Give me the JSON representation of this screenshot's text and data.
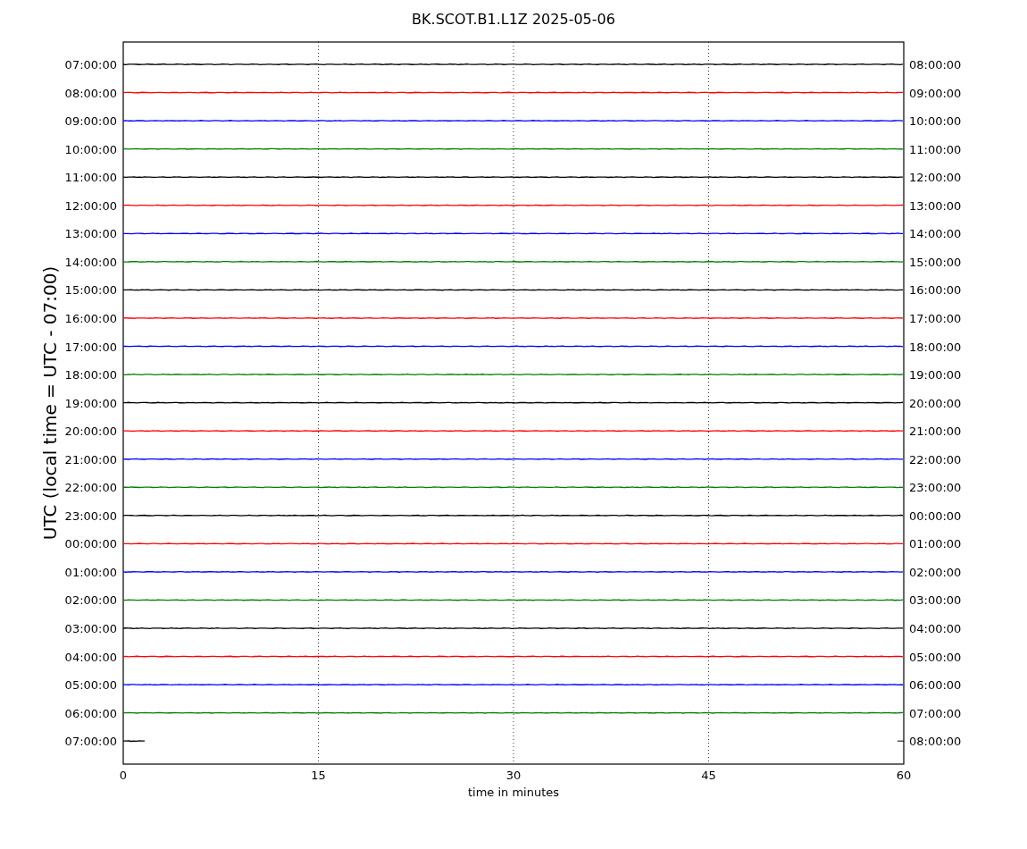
{
  "title": "BK.SCOT.B1.L1Z 2025-05-06",
  "ylabel": "UTC (local time = UTC - 07:00)",
  "xlabel": "time in minutes",
  "xticks": [
    "0",
    "15",
    "30",
    "45",
    "60"
  ],
  "traces": [
    {
      "left": "07:00:00",
      "right": "08:00:00",
      "color": "#000000",
      "kind": "full"
    },
    {
      "left": "08:00:00",
      "right": "09:00:00",
      "color": "#ff0000",
      "kind": "full"
    },
    {
      "left": "09:00:00",
      "right": "10:00:00",
      "color": "#0000ff",
      "kind": "full"
    },
    {
      "left": "10:00:00",
      "right": "11:00:00",
      "color": "#008000",
      "kind": "full"
    },
    {
      "left": "11:00:00",
      "right": "12:00:00",
      "color": "#000000",
      "kind": "full"
    },
    {
      "left": "12:00:00",
      "right": "13:00:00",
      "color": "#ff0000",
      "kind": "full"
    },
    {
      "left": "13:00:00",
      "right": "14:00:00",
      "color": "#0000ff",
      "kind": "full"
    },
    {
      "left": "14:00:00",
      "right": "15:00:00",
      "color": "#008000",
      "kind": "full"
    },
    {
      "left": "15:00:00",
      "right": "16:00:00",
      "color": "#000000",
      "kind": "full"
    },
    {
      "left": "16:00:00",
      "right": "17:00:00",
      "color": "#ff0000",
      "kind": "full"
    },
    {
      "left": "17:00:00",
      "right": "18:00:00",
      "color": "#0000ff",
      "kind": "full"
    },
    {
      "left": "18:00:00",
      "right": "19:00:00",
      "color": "#008000",
      "kind": "full"
    },
    {
      "left": "19:00:00",
      "right": "20:00:00",
      "color": "#000000",
      "kind": "full"
    },
    {
      "left": "20:00:00",
      "right": "21:00:00",
      "color": "#ff0000",
      "kind": "full"
    },
    {
      "left": "21:00:00",
      "right": "22:00:00",
      "color": "#0000ff",
      "kind": "full"
    },
    {
      "left": "22:00:00",
      "right": "23:00:00",
      "color": "#008000",
      "kind": "full"
    },
    {
      "left": "23:00:00",
      "right": "00:00:00",
      "color": "#000000",
      "kind": "full"
    },
    {
      "left": "00:00:00",
      "right": "01:00:00",
      "color": "#ff0000",
      "kind": "full"
    },
    {
      "left": "01:00:00",
      "right": "02:00:00",
      "color": "#0000ff",
      "kind": "full"
    },
    {
      "left": "02:00:00",
      "right": "03:00:00",
      "color": "#008000",
      "kind": "full"
    },
    {
      "left": "03:00:00",
      "right": "04:00:00",
      "color": "#000000",
      "kind": "full"
    },
    {
      "left": "04:00:00",
      "right": "05:00:00",
      "color": "#ff0000",
      "kind": "full"
    },
    {
      "left": "05:00:00",
      "right": "06:00:00",
      "color": "#0000ff",
      "kind": "full"
    },
    {
      "left": "06:00:00",
      "right": "07:00:00",
      "color": "#008000",
      "kind": "full"
    },
    {
      "left": "07:00:00",
      "right": "08:00:00",
      "color": "#000000",
      "kind": "partial"
    }
  ]
}
